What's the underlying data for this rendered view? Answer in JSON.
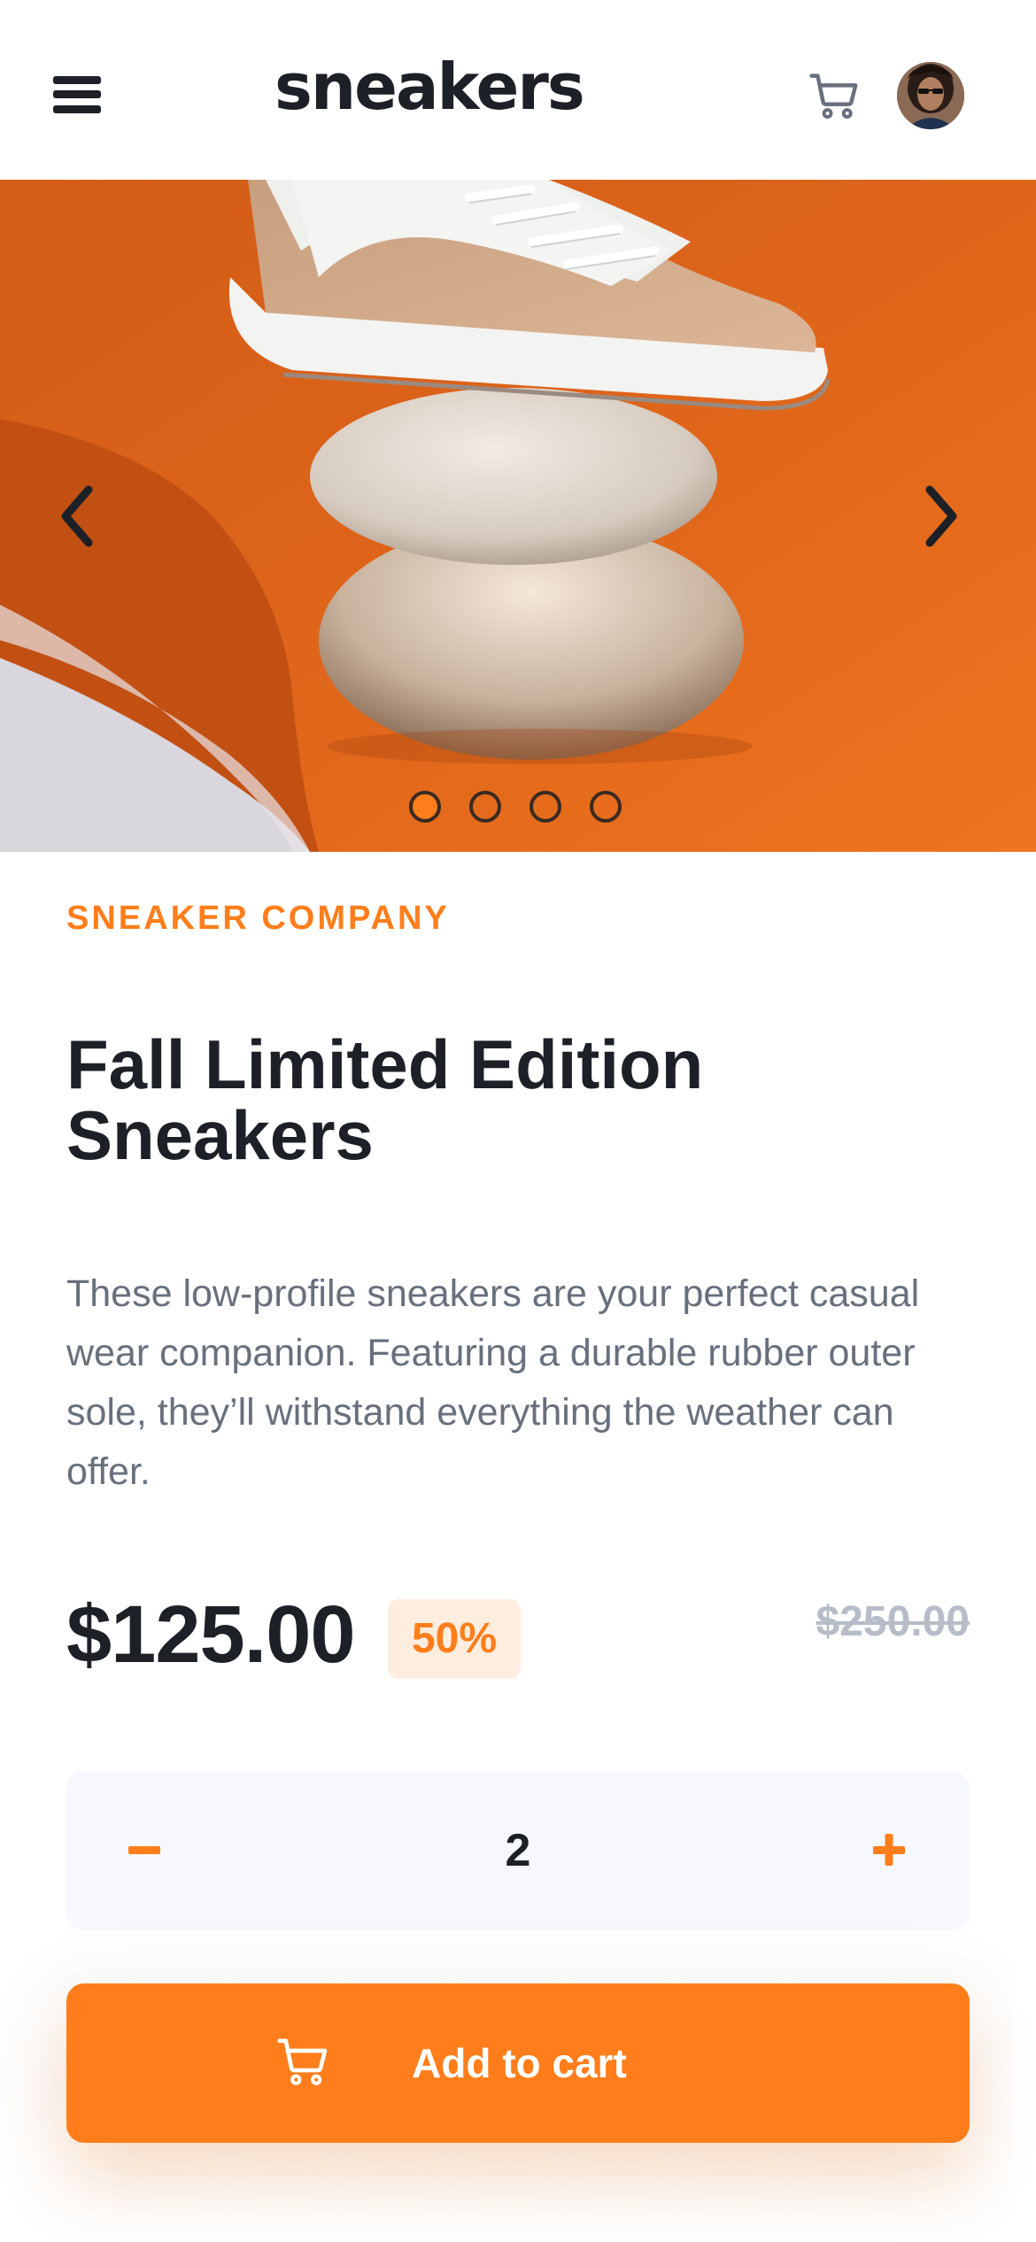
{
  "header": {
    "logo": "sneakers",
    "menu_icon": "hamburger-menu-icon",
    "cart_icon": "cart-icon",
    "avatar_icon": "user-avatar"
  },
  "gallery": {
    "prev_icon": "chevron-left-icon",
    "next_icon": "chevron-right-icon",
    "active_index": 0,
    "image_count": 4
  },
  "product": {
    "company": "SNEAKER COMPANY",
    "title": "Fall Limited Edition Sneakers",
    "description": "These low-profile sneakers are your perfect casual wear companion. Featuring a durable rubber outer sole, they’ll withstand everything the weather can offer.",
    "price": "$125.00",
    "discount": "50%",
    "original_price": "$250.00"
  },
  "quantity": {
    "value": "2",
    "minus_icon": "minus-icon",
    "plus_icon": "plus-icon"
  },
  "cta": {
    "label": "Add to cart",
    "icon": "cart-icon"
  },
  "colors": {
    "accent": "#ff7e1b",
    "accent_pale": "#ffede0",
    "text_dark": "#1d2026",
    "text_gray": "#68707d",
    "muted": "#b6bcc8",
    "field_bg": "#f6f8fd"
  }
}
